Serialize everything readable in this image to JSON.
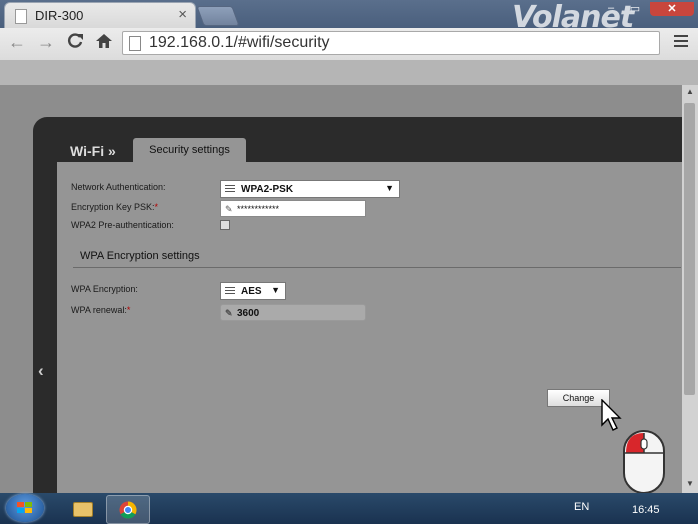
{
  "browser": {
    "tab_title": "DIR-300",
    "tab_close": "×",
    "url": "192.168.0.1/#wifi/security",
    "brand": "Volanet",
    "window_controls": {
      "minimize": "–",
      "maximize": "▭",
      "close": "✕"
    },
    "nav": {
      "back": "←",
      "forward": "→",
      "reload": "C",
      "home": "⌂"
    }
  },
  "router": {
    "breadcrumb": "Wi-Fi »",
    "section_tab": "Security settings",
    "fields": {
      "network_auth_label": "Network Authentication:",
      "network_auth_value": "WPA2-PSK",
      "psk_label": "Encryption Key PSK:",
      "psk_required": "*",
      "psk_value": "************",
      "preauth_label": "WPA2 Pre-authentication:",
      "preauth_checked": false
    },
    "wpa_section_title": "WPA Encryption settings",
    "wpa": {
      "encryption_label": "WPA Encryption:",
      "encryption_value": "AES",
      "renewal_label": "WPA renewal:",
      "renewal_required": "*",
      "renewal_value": "3600"
    },
    "change_button": "Change",
    "side_arrow": "‹"
  },
  "taskbar": {
    "language": "EN",
    "time": "16:45"
  },
  "colors": {
    "panel_dark": "#2b2b2b",
    "content_gray": "#959595",
    "required_marker": "#b00000",
    "taskbar": "#1a3250"
  }
}
